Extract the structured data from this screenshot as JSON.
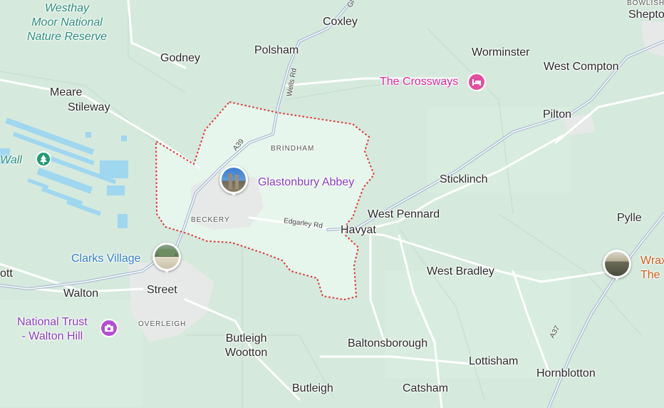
{
  "map": {
    "places": {
      "coxley": "Coxley",
      "godney": "Godney",
      "polsham": "Polsham",
      "worminster": "Worminster",
      "west_compton": "West Compton",
      "meare": "Meare",
      "stileway": "Stileway",
      "pilton": "Pilton",
      "brindham": "BRINDHAM",
      "beckery": "BECKERY",
      "havyat": "Havyat",
      "sticklinch": "Sticklinch",
      "west_pennard": "West Pennard",
      "pylle": "Pylle",
      "walton": "Walton",
      "street": "Street",
      "overleigh": "OVERLEIGH",
      "west_bradley": "West Bradley",
      "butleigh_wootton": "Butleigh\nWootton",
      "baltonsborough": "Baltonsborough",
      "lottisham": "Lottisham",
      "hornblotton": "Hornblotton",
      "butleigh": "Butleigh",
      "catsham": "Catsham",
      "shepton_partial": "Shepto",
      "bowlish_partial": "BOWLISH",
      "ott_partial": "ott"
    },
    "nature": {
      "westhay": "Westhay\nMoor National\nNature Reserve",
      "wall_partial": "Wall"
    },
    "pois": {
      "crossways": "The Crossways",
      "glastonbury_abbey": "Glastonbury Abbey",
      "clarks_village": "Clarks Village",
      "national_trust": "National Trust\n- Walton Hill",
      "wrax_partial": "Wrax\nThe"
    },
    "roads": {
      "a39": "A39",
      "wells_rd": "Wells Rd",
      "edgarley_rd": "Edgarley Rd",
      "a37": "A37",
      "top_road": "Gl"
    },
    "colors": {
      "land": "#d5e9dd",
      "highlight": "#e6f6ec",
      "boundary": "#e0332f",
      "road": "#ffffff",
      "major_road": "#a9bbd0",
      "water": "#9fd7ef",
      "urban": "#e8ebe9"
    },
    "icons": {
      "crossways": "hotel-icon",
      "national_trust": "camera-icon",
      "wall": "tree-icon"
    }
  }
}
